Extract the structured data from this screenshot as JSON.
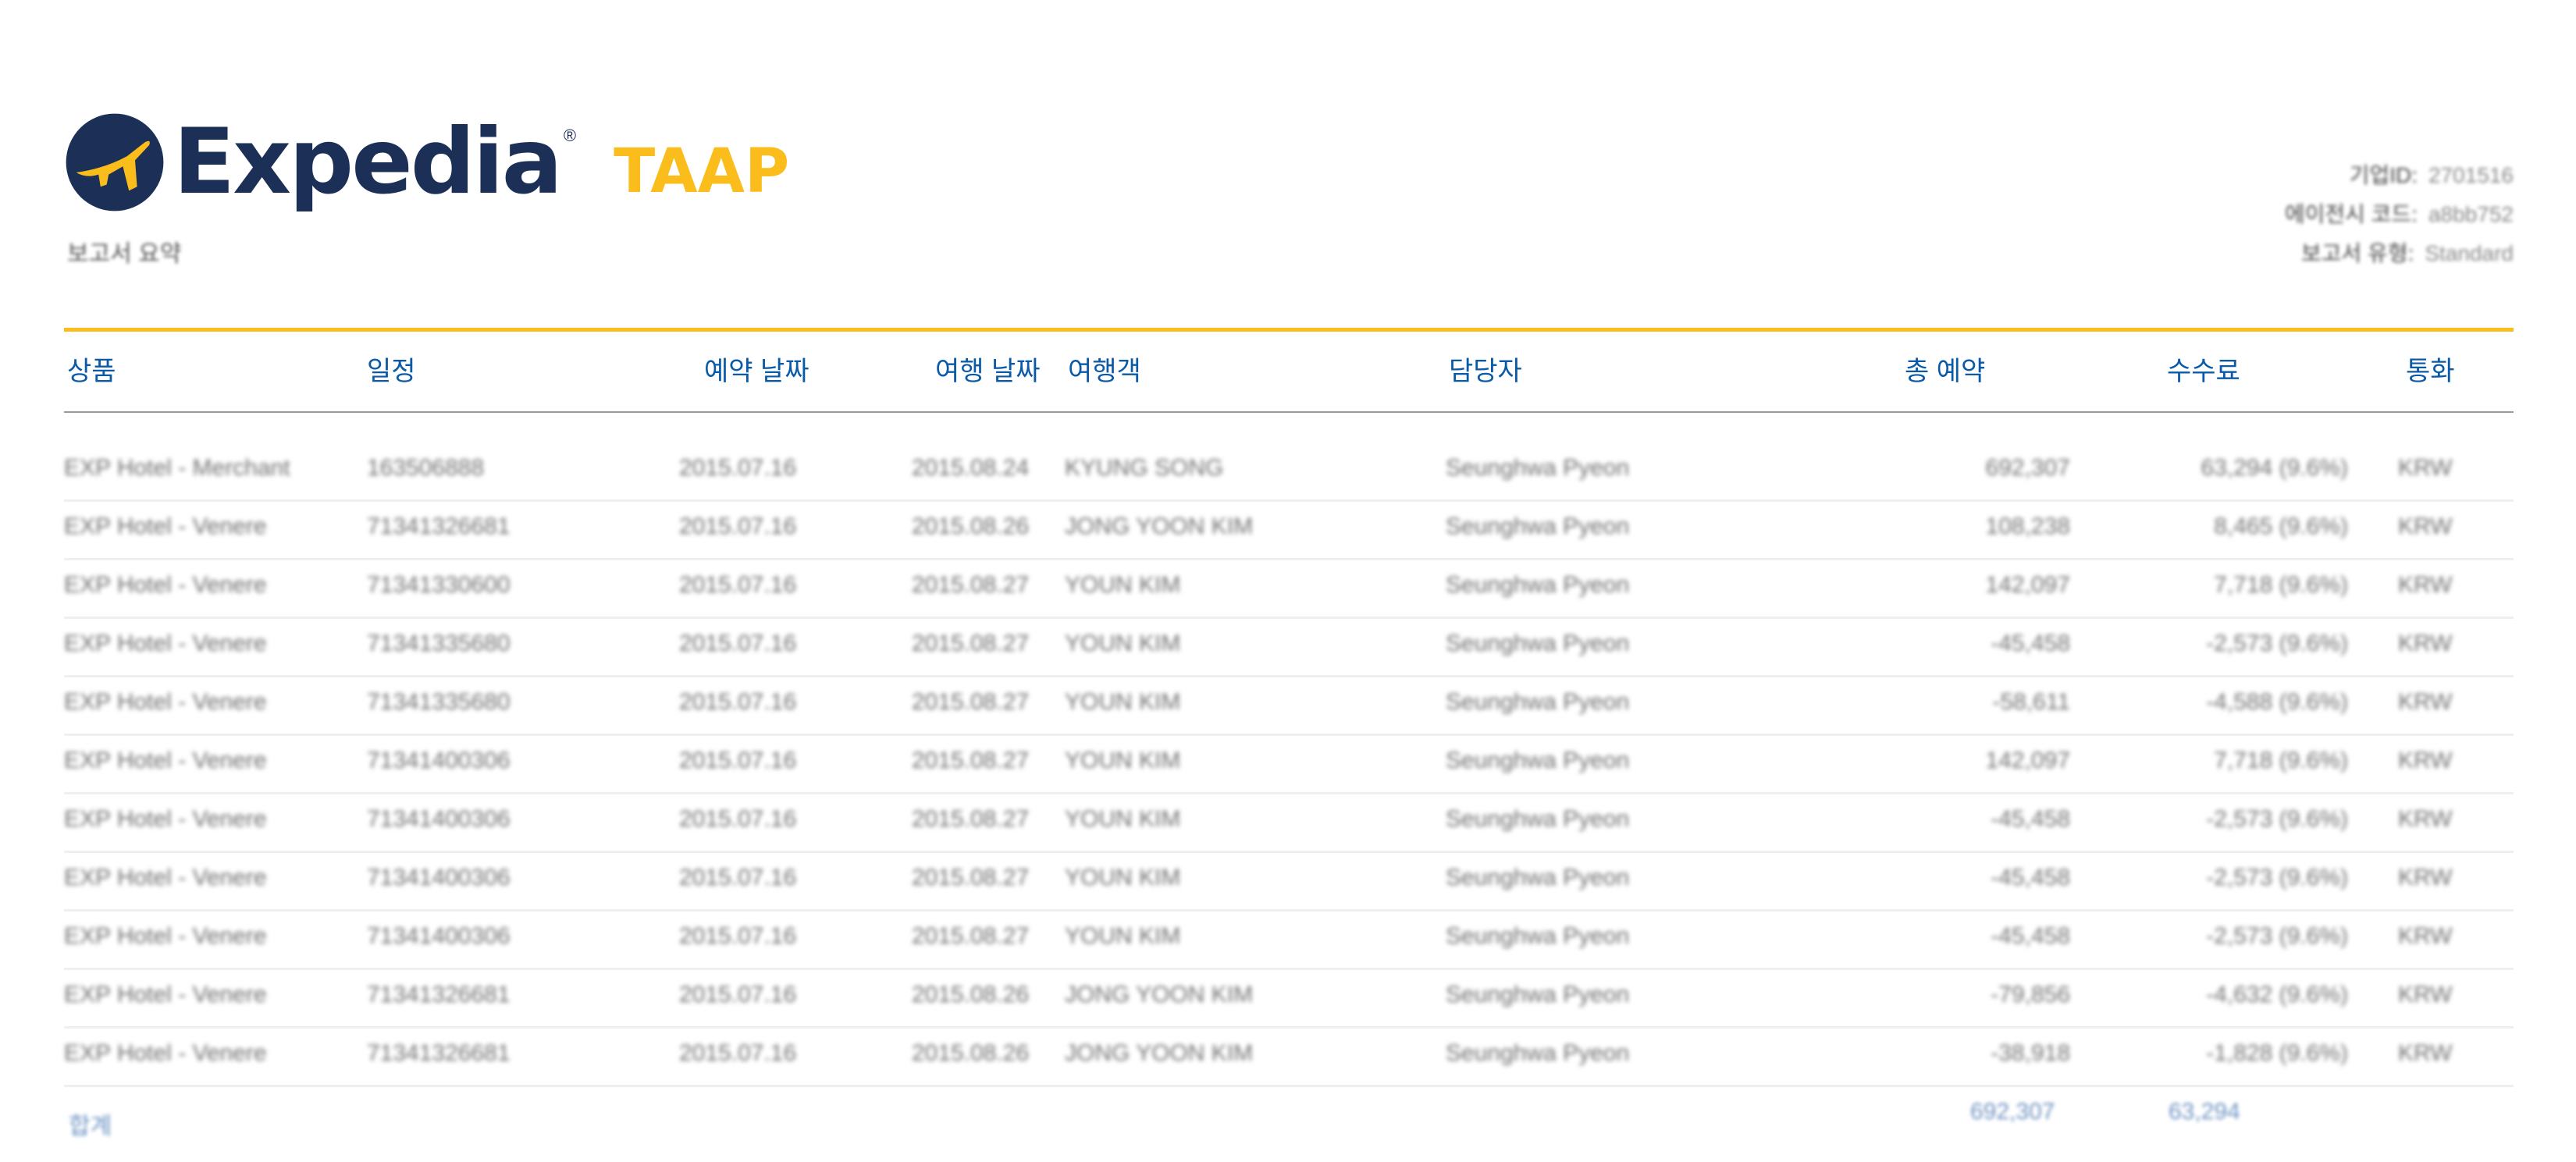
{
  "brand": {
    "logo_icon": "expedia-globe-icon",
    "name": "Expedia",
    "suffix": "TAAP",
    "colors": {
      "navy": "#1b2f57",
      "gold": "#fbbd1b",
      "header_blue": "#0b5aa8"
    }
  },
  "report": {
    "label": "보고서 요약"
  },
  "meta": [
    {
      "label": "기업ID:",
      "value": "2701516"
    },
    {
      "label": "에이전시 코드:",
      "value": "a8bb752"
    },
    {
      "label": "보고서 유형:",
      "value": "Standard"
    }
  ],
  "table": {
    "headers": [
      "상품",
      "일정",
      "예약 날짜",
      "여행 날짜",
      "여행객",
      "담당자",
      "총 예약",
      "수수료",
      "통화"
    ],
    "rows": [
      [
        "EXP Hotel - Merchant",
        "163506888",
        "2015.07.16",
        "2015.08.24",
        "KYUNG SONG",
        "Seunghwa Pyeon",
        "692,307",
        "63,294 (9.6%)",
        "KRW"
      ],
      [
        "EXP Hotel - Venere",
        "71341326681",
        "2015.07.16",
        "2015.08.26",
        "JONG YOON KIM",
        "Seunghwa Pyeon",
        "108,238",
        "8,465 (9.6%)",
        "KRW"
      ],
      [
        "EXP Hotel - Venere",
        "71341330600",
        "2015.07.16",
        "2015.08.27",
        "YOUN KIM",
        "Seunghwa Pyeon",
        "142,097",
        "7,718 (9.6%)",
        "KRW"
      ],
      [
        "EXP Hotel - Venere",
        "71341335680",
        "2015.07.16",
        "2015.08.27",
        "YOUN KIM",
        "Seunghwa Pyeon",
        "-45,458",
        "-2,573 (9.6%)",
        "KRW"
      ],
      [
        "EXP Hotel - Venere",
        "71341335680",
        "2015.07.16",
        "2015.08.27",
        "YOUN KIM",
        "Seunghwa Pyeon",
        "-58,611",
        "-4,588 (9.6%)",
        "KRW"
      ],
      [
        "EXP Hotel - Venere",
        "71341400306",
        "2015.07.16",
        "2015.08.27",
        "YOUN KIM",
        "Seunghwa Pyeon",
        "142,097",
        "7,718 (9.6%)",
        "KRW"
      ],
      [
        "EXP Hotel - Venere",
        "71341400306",
        "2015.07.16",
        "2015.08.27",
        "YOUN KIM",
        "Seunghwa Pyeon",
        "-45,458",
        "-2,573 (9.6%)",
        "KRW"
      ],
      [
        "EXP Hotel - Venere",
        "71341400306",
        "2015.07.16",
        "2015.08.27",
        "YOUN KIM",
        "Seunghwa Pyeon",
        "-45,458",
        "-2,573 (9.6%)",
        "KRW"
      ],
      [
        "EXP Hotel - Venere",
        "71341400306",
        "2015.07.16",
        "2015.08.27",
        "YOUN KIM",
        "Seunghwa Pyeon",
        "-45,458",
        "-2,573 (9.6%)",
        "KRW"
      ],
      [
        "EXP Hotel - Venere",
        "71341326681",
        "2015.07.16",
        "2015.08.26",
        "JONG YOON KIM",
        "Seunghwa Pyeon",
        "-79,856",
        "-4,632 (9.6%)",
        "KRW"
      ],
      [
        "EXP Hotel - Venere",
        "71341326681",
        "2015.07.16",
        "2015.08.26",
        "JONG YOON KIM",
        "Seunghwa Pyeon",
        "-38,918",
        "-1,828 (9.6%)",
        "KRW"
      ]
    ]
  },
  "totals": {
    "label": "합계",
    "total_booking": "692,307",
    "commission": "63,294"
  }
}
